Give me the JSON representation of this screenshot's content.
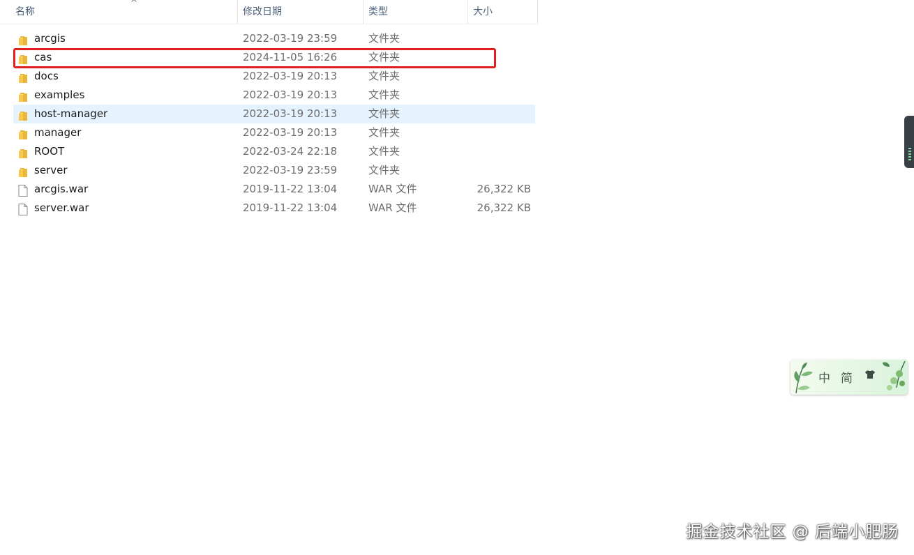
{
  "columns": {
    "name": "名称",
    "date": "修改日期",
    "type": "类型",
    "size": "大小"
  },
  "sort_arrow": "^",
  "files": [
    {
      "name": "arcgis",
      "date": "2022-03-19 23:59",
      "type": "文件夹",
      "size": "",
      "icon": "folder-icon",
      "selected": false,
      "highlighted": false
    },
    {
      "name": "cas",
      "date": "2024-11-05 16:26",
      "type": "文件夹",
      "size": "",
      "icon": "folder-icon",
      "selected": false,
      "highlighted": true
    },
    {
      "name": "docs",
      "date": "2022-03-19 20:13",
      "type": "文件夹",
      "size": "",
      "icon": "folder-icon",
      "selected": false,
      "highlighted": false
    },
    {
      "name": "examples",
      "date": "2022-03-19 20:13",
      "type": "文件夹",
      "size": "",
      "icon": "folder-icon",
      "selected": false,
      "highlighted": false
    },
    {
      "name": "host-manager",
      "date": "2022-03-19 20:13",
      "type": "文件夹",
      "size": "",
      "icon": "folder-icon",
      "selected": true,
      "highlighted": false
    },
    {
      "name": "manager",
      "date": "2022-03-19 20:13",
      "type": "文件夹",
      "size": "",
      "icon": "folder-icon",
      "selected": false,
      "highlighted": false
    },
    {
      "name": "ROOT",
      "date": "2022-03-24 22:18",
      "type": "文件夹",
      "size": "",
      "icon": "folder-icon",
      "selected": false,
      "highlighted": false
    },
    {
      "name": "server",
      "date": "2022-03-19 23:59",
      "type": "文件夹",
      "size": "",
      "icon": "folder-icon",
      "selected": false,
      "highlighted": false
    },
    {
      "name": "arcgis.war",
      "date": "2019-11-22 13:04",
      "type": "WAR 文件",
      "size": "26,322 KB",
      "icon": "file-icon",
      "selected": false,
      "highlighted": false
    },
    {
      "name": "server.war",
      "date": "2019-11-22 13:04",
      "type": "WAR 文件",
      "size": "26,322 KB",
      "icon": "file-icon",
      "selected": false,
      "highlighted": false
    }
  ],
  "ime": {
    "mode_label": "中",
    "script_label": "简",
    "skin_icon": "shirt-icon"
  },
  "watermark": "掘金技术社区 @ 后端小肥肠",
  "colors": {
    "selected_row": "#e5f3ff",
    "highlight_border": "#e0201e",
    "folder": "#f6c94e"
  }
}
